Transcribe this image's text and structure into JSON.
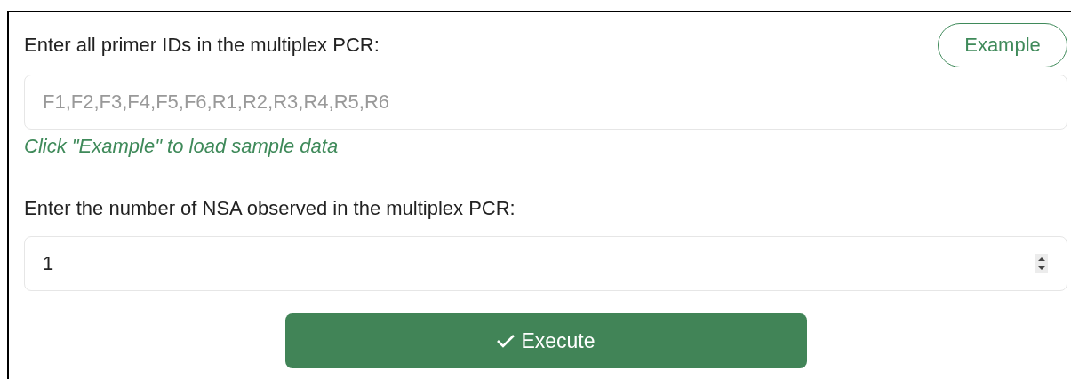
{
  "primers": {
    "label": "Enter all primer IDs in the multiplex PCR:",
    "example_button": "Example",
    "placeholder": "F1,F2,F3,F4,F5,F6,R1,R2,R3,R4,R5,R6",
    "hint": "Click \"Example\" to load sample data"
  },
  "nsa": {
    "label": "Enter the number of NSA observed in the multiplex PCR:",
    "value": "1"
  },
  "execute_button": "Execute"
}
